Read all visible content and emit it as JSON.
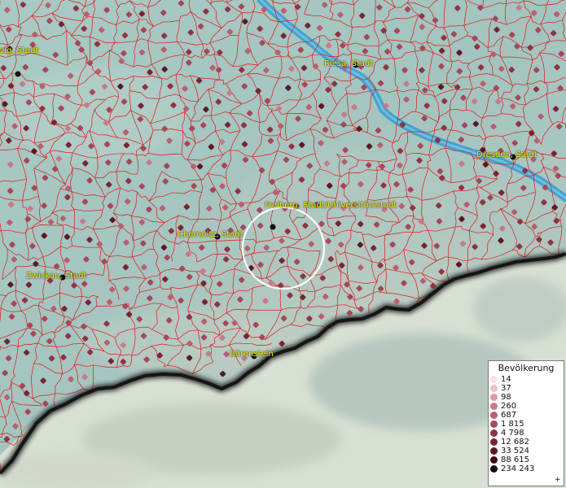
{
  "map": {
    "places": [
      {
        "name": "Leipzig, Stadt",
        "label": "zig, Stadt"
      },
      {
        "name": "Riesa, Stadt",
        "label": "Riesa, Stadt"
      },
      {
        "name": "Dresden, Stadt",
        "label": "Dresden, Stadt"
      },
      {
        "name": "Freiberg, Stadt/Universitätsstadt",
        "label": "Freiberg, Stadt/Universitätsstadt"
      },
      {
        "name": "Chemnitz, Stadt",
        "label": "Chemnitz, Stadt"
      },
      {
        "name": "Zwickau, Stadt",
        "label": "Zwickau, Stadt"
      },
      {
        "name": "Bärenstein",
        "label": "Bärenstein"
      }
    ],
    "colors": {
      "river": "#3a9fd0",
      "boundaries": "#e01818",
      "label_text": "#f6f300",
      "border": "#1a1a1a",
      "highlight_circle": "#ffffff"
    }
  },
  "legend": {
    "title": "Bevölkerung",
    "items": [
      {
        "label": "14",
        "color": "#f6dfe5"
      },
      {
        "label": "37",
        "color": "#e9c2cb"
      },
      {
        "label": "98",
        "color": "#d99aa7"
      },
      {
        "label": "260",
        "color": "#c97a89"
      },
      {
        "label": "687",
        "color": "#b85f70"
      },
      {
        "label": "1 815",
        "color": "#a4485a"
      },
      {
        "label": "4 798",
        "color": "#8e3445"
      },
      {
        "label": "12 682",
        "color": "#762534"
      },
      {
        "label": "33 524",
        "color": "#5c1825"
      },
      {
        "label": "88 615",
        "color": "#420d17"
      },
      {
        "label": "234 243",
        "color": "#22050a"
      }
    ],
    "plus": "+"
  }
}
